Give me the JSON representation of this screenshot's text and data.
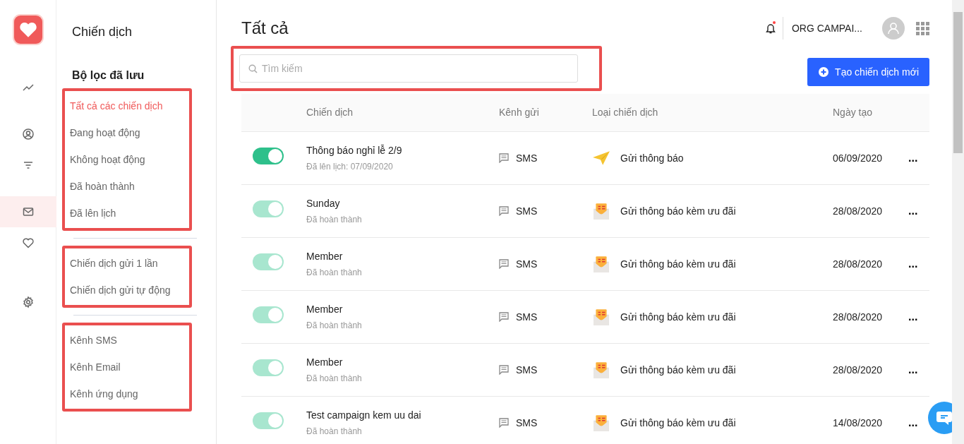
{
  "rail": {
    "items": [
      {
        "kind": "trend",
        "selected": false
      },
      {
        "kind": "user",
        "selected": false
      },
      {
        "kind": "filter",
        "selected": false
      },
      {
        "kind": "mail",
        "selected": true
      },
      {
        "kind": "heart",
        "selected": false
      },
      {
        "kind": "gear",
        "selected": false
      }
    ]
  },
  "filters": {
    "title": "Chiến dịch",
    "subtitle": "Bộ lọc đã lưu",
    "groups": [
      {
        "highlighted": true,
        "items": [
          {
            "label": "Tất cả các chiến dịch",
            "selected": true
          },
          {
            "label": "Đang hoạt động",
            "selected": false
          },
          {
            "label": "Không hoạt động",
            "selected": false
          },
          {
            "label": "Đã hoàn thành",
            "selected": false
          },
          {
            "label": "Đã lên lịch",
            "selected": false
          }
        ]
      },
      {
        "highlighted": true,
        "items": [
          {
            "label": "Chiến dịch gửi 1 lần",
            "selected": false
          },
          {
            "label": "Chiến dịch gửi tự động",
            "selected": false
          }
        ]
      },
      {
        "highlighted": true,
        "items": [
          {
            "label": "Kênh SMS",
            "selected": false
          },
          {
            "label": "Kênh Email",
            "selected": false
          },
          {
            "label": "Kênh ứng dụng",
            "selected": false
          }
        ]
      }
    ]
  },
  "header": {
    "title": "Tất cả",
    "notification_dot": true,
    "org": "ORG CAMPAI..."
  },
  "search": {
    "placeholder": "Tìm kiếm",
    "highlighted": true
  },
  "create_button": "Tạo chiến dịch mới",
  "table": {
    "columns": [
      "Chiến dịch",
      "Kênh gửi",
      "Loại chiến dịch",
      "Ngày tạo"
    ],
    "rows": [
      {
        "on": true,
        "disabled": false,
        "name": "Thông báo nghỉ lễ 2/9",
        "status": "Đã lên lịch: 07/09/2020",
        "channel": "SMS",
        "type": {
          "kind": "notice",
          "label": "Gửi thông báo"
        },
        "date": "06/09/2020",
        "more": "..."
      },
      {
        "on": true,
        "disabled": true,
        "name": "Sunday",
        "status": "Đã hoàn thành",
        "channel": "SMS",
        "type": {
          "kind": "offer",
          "label": "Gửi thông báo kèm ưu đãi"
        },
        "date": "28/08/2020",
        "more": "..."
      },
      {
        "on": true,
        "disabled": true,
        "name": "Member",
        "status": "Đã hoàn thành",
        "channel": "SMS",
        "type": {
          "kind": "offer",
          "label": "Gửi thông báo kèm ưu đãi"
        },
        "date": "28/08/2020",
        "more": "..."
      },
      {
        "on": true,
        "disabled": true,
        "name": "Member",
        "status": "Đã hoàn thành",
        "channel": "SMS",
        "type": {
          "kind": "offer",
          "label": "Gửi thông báo kèm ưu đãi"
        },
        "date": "28/08/2020",
        "more": "..."
      },
      {
        "on": true,
        "disabled": true,
        "name": "Member",
        "status": "Đã hoàn thành",
        "channel": "SMS",
        "type": {
          "kind": "offer",
          "label": "Gửi thông báo kèm ưu đãi"
        },
        "date": "28/08/2020",
        "more": "..."
      },
      {
        "on": true,
        "disabled": true,
        "name": "Test campaign kem uu dai",
        "status": "Đã hoàn thành",
        "channel": "SMS",
        "type": {
          "kind": "offer",
          "label": "Gửi thông báo kèm ưu đãi"
        },
        "date": "14/08/2020",
        "more": "..."
      }
    ]
  }
}
